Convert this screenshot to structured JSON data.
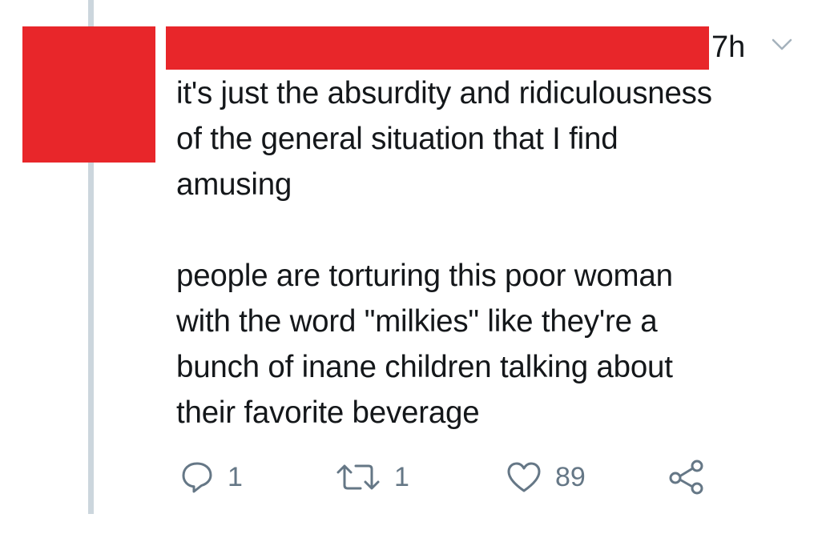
{
  "tweet": {
    "timestamp": "7h",
    "paragraphs": [
      "it's just the absurdity and ridiculousness\nof the general situation that I find\namusing",
      "people are torturing this poor woman\nwith the word \"milkies\" like they're a\nbunch of inane children talking about\ntheir favorite beverage"
    ]
  },
  "actions": {
    "reply_count": "1",
    "retweet_count": "1",
    "like_count": "89"
  },
  "icons": {
    "reply": "reply-icon",
    "retweet": "retweet-icon",
    "like": "heart-icon",
    "share": "share-icon",
    "caret": "chevron-down-icon"
  },
  "colors": {
    "redaction": "#e8262a",
    "thread_line": "#ccd6dd",
    "icon_gray": "#657786",
    "text": "#14171a"
  }
}
